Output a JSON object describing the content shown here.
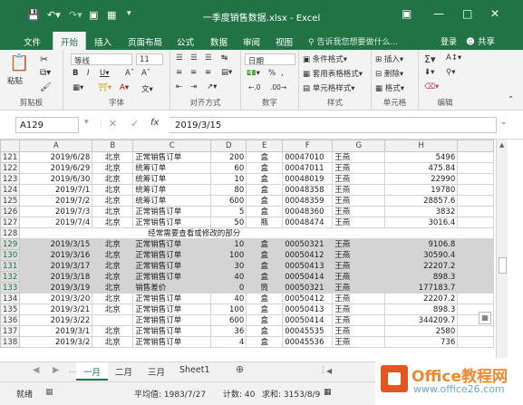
{
  "title_bar": {
    "title": "一季度销售数据.xlsx - Excel",
    "save_icon": "save-icon",
    "undo_icon": "undo-icon",
    "redo_icon": "redo-icon"
  },
  "tabs": [
    "文件",
    "开始",
    "插入",
    "页面布局",
    "公式",
    "数据",
    "审阅",
    "视图"
  ],
  "active_tab": "开始",
  "tell_me": "告诉我您想要做什么...",
  "login": "登录",
  "share": "共享",
  "ribbon": {
    "clipboard": {
      "label": "剪贴板",
      "paste": "粘贴"
    },
    "font": {
      "label": "字体",
      "name": "等线",
      "size": "11"
    },
    "alignment": {
      "label": "对齐方式"
    },
    "number": {
      "label": "数字",
      "format": "日期"
    },
    "styles": {
      "label": "样式",
      "conditional": "条件格式",
      "table": "套用表格格式",
      "cell": "单元格样式"
    },
    "cells": {
      "label": "单元格",
      "insert": "插入",
      "delete": "删除",
      "format": "格式"
    },
    "editing": {
      "label": "编辑"
    }
  },
  "formula_bar": {
    "name_box": "A129",
    "fx": "fx",
    "value": "2019/3/15"
  },
  "grid": {
    "columns": [
      "A",
      "B",
      "C",
      "D",
      "E",
      "F",
      "G",
      "H"
    ],
    "rows": [
      {
        "n": "121",
        "a": "2019/6/28",
        "b": "北京",
        "c": "正常销售订单",
        "d": "200",
        "e": "盒",
        "f": "00047010",
        "g": "王燕",
        "h": "5496"
      },
      {
        "n": "122",
        "a": "2019/6/29",
        "b": "北京",
        "c": "统筹订单",
        "d": "60",
        "e": "盒",
        "f": "00047011",
        "g": "王燕",
        "h": "475.84"
      },
      {
        "n": "123",
        "a": "2019/6/30",
        "b": "北京",
        "c": "统筹订单",
        "d": "10",
        "e": "盒",
        "f": "00048019",
        "g": "王燕",
        "h": "22990"
      },
      {
        "n": "124",
        "a": "2019/7/1",
        "b": "北京",
        "c": "统筹订单",
        "d": "80",
        "e": "盒",
        "f": "00048358",
        "g": "王燕",
        "h": "19780"
      },
      {
        "n": "125",
        "a": "2019/7/2",
        "b": "北京",
        "c": "统筹订单",
        "d": "600",
        "e": "盒",
        "f": "00048359",
        "g": "王燕",
        "h": "28857.6"
      },
      {
        "n": "126",
        "a": "2019/7/3",
        "b": "北京",
        "c": "正常销售订单",
        "d": "5",
        "e": "盒",
        "f": "00048360",
        "g": "王燕",
        "h": "3832"
      },
      {
        "n": "127",
        "a": "2019/7/4",
        "b": "北京",
        "c": "正常销售订单",
        "d": "50",
        "e": "瓶",
        "f": "00048474",
        "g": "王燕",
        "h": "3016.4"
      },
      {
        "n": "128",
        "merged": "经常需要查看或修改的部分"
      },
      {
        "n": "129",
        "a": "2019/3/15",
        "b": "北京",
        "c": "正常销售订单",
        "d": "10",
        "e": "盒",
        "f": "00050321",
        "g": "王燕",
        "h": "9106.8",
        "sel": true
      },
      {
        "n": "130",
        "a": "2019/3/16",
        "b": "北京",
        "c": "正常销售订单",
        "d": "100",
        "e": "盒",
        "f": "00050412",
        "g": "王燕",
        "h": "30590.4",
        "sel": true
      },
      {
        "n": "131",
        "a": "2019/3/17",
        "b": "北京",
        "c": "正常销售订单",
        "d": "30",
        "e": "盒",
        "f": "00050413",
        "g": "王燕",
        "h": "22207.2",
        "sel": true
      },
      {
        "n": "132",
        "a": "2019/3/18",
        "b": "北京",
        "c": "正常销售订单",
        "d": "40",
        "e": "盒",
        "f": "00050414",
        "g": "王燕",
        "h": "898.3",
        "sel": true
      },
      {
        "n": "133",
        "a": "2019/3/19",
        "b": "北京",
        "c": "销售差价",
        "d": "0",
        "e": "筒",
        "f": "00050321",
        "g": "王燕",
        "h": "177183.7",
        "sel": true
      },
      {
        "n": "134",
        "a": "2019/3/20",
        "b": "北京",
        "c": "正常销售订单",
        "d": "40",
        "e": "盒",
        "f": "00050412",
        "g": "王燕",
        "h": "22207.2"
      },
      {
        "n": "135",
        "a": "2019/3/21",
        "b": "北京",
        "c": "正常销售订单",
        "d": "100",
        "e": "盒",
        "f": "00050413",
        "g": "王燕",
        "h": "898.3"
      },
      {
        "n": "136",
        "a": "2019/3/22",
        "b": "",
        "c": "正常销售订单",
        "d": "600",
        "e": "盒",
        "f": "00050414",
        "g": "王燕",
        "h": "344209.7"
      },
      {
        "n": "137",
        "a": "2019/3/1",
        "b": "北京",
        "c": "正常销售订单",
        "d": "36",
        "e": "盒",
        "f": "00045535",
        "g": "王燕",
        "h": "2580"
      },
      {
        "n": "138",
        "a": "2019/3/2",
        "b": "北京",
        "c": "正常销售订单",
        "d": "4",
        "e": "盒",
        "f": "00045536",
        "g": "王燕",
        "h": "736"
      }
    ]
  },
  "sheets": [
    "一月",
    "二月",
    "三月",
    "Sheet1"
  ],
  "active_sheet": "一月",
  "status": {
    "mode": "就绪",
    "average": "平均值: 1983/7/27",
    "count": "计数: 40",
    "sum": "求和: 3153/8/9"
  },
  "watermark": {
    "brand": "Office教程网",
    "url": "www.office26.com"
  },
  "colors": {
    "accent": "#217346",
    "selection": "#d4d4d4",
    "logo_orange": "#e2571f"
  }
}
